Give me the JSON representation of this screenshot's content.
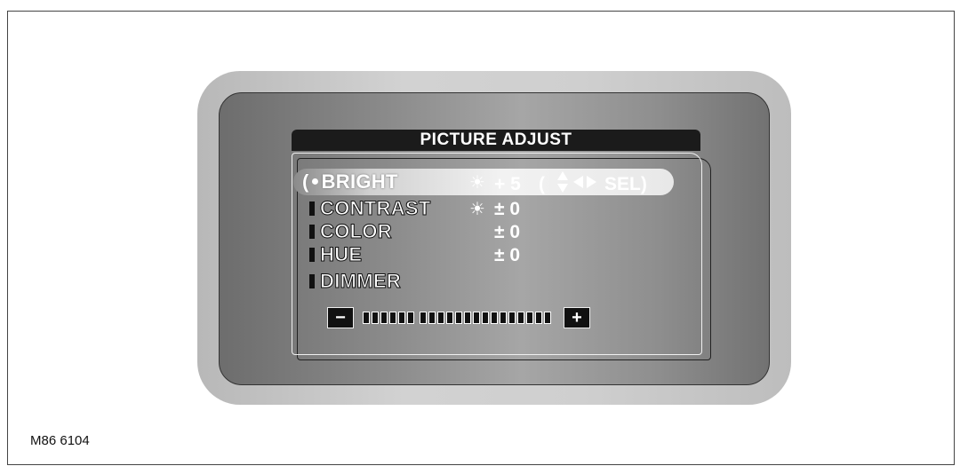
{
  "figure": {
    "id": "M86 6104"
  },
  "menu": {
    "title": "PICTURE ADJUST",
    "items": [
      {
        "label": "BRIGHT",
        "value": "+ 5",
        "hint": "( ◀▶ SEL)",
        "selected": true,
        "has_sun_icon": true
      },
      {
        "label": "CONTRAST",
        "value": "± 0",
        "selected": false,
        "has_sun_icon": true
      },
      {
        "label": "COLOR",
        "value": "± 0",
        "selected": false,
        "has_sun_icon": false
      },
      {
        "label": "HUE",
        "value": "± 0",
        "selected": false,
        "has_sun_icon": false
      },
      {
        "label": "DIMMER",
        "value": "",
        "selected": false,
        "has_sun_icon": false
      }
    ],
    "bright_hint_open": "(",
    "bright_hint_sel": "SEL)",
    "bullet": "●",
    "slider": {
      "minus_label": "−",
      "plus_label": "+",
      "segments_total": 21,
      "segments_groups": [
        6,
        15
      ]
    }
  }
}
